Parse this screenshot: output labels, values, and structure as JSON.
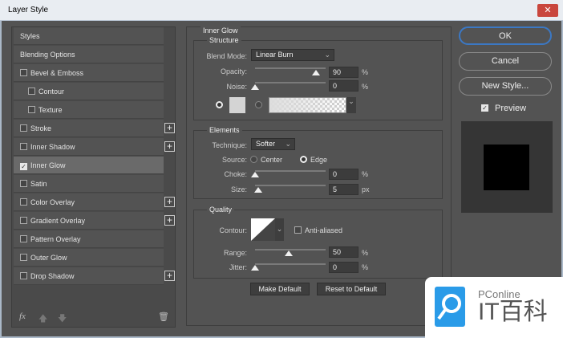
{
  "window": {
    "title": "Layer Style",
    "close": "✕"
  },
  "sidebar": {
    "items": [
      {
        "label": "Styles"
      },
      {
        "label": "Blending Options"
      },
      {
        "label": "Bevel & Emboss"
      },
      {
        "label": "Contour"
      },
      {
        "label": "Texture"
      },
      {
        "label": "Stroke"
      },
      {
        "label": "Inner Shadow"
      },
      {
        "label": "Inner Glow"
      },
      {
        "label": "Satin"
      },
      {
        "label": "Color Overlay"
      },
      {
        "label": "Gradient Overlay"
      },
      {
        "label": "Pattern Overlay"
      },
      {
        "label": "Outer Glow"
      },
      {
        "label": "Drop Shadow"
      }
    ],
    "fx": "fx"
  },
  "panel": {
    "title": "Inner Glow",
    "structure": {
      "title": "Structure",
      "blend_label": "Blend Mode:",
      "blend_value": "Linear Burn",
      "opacity_label": "Opacity:",
      "opacity": "90",
      "noise_label": "Noise:",
      "noise": "0",
      "unit": "%"
    },
    "elements": {
      "title": "Elements",
      "technique_label": "Technique:",
      "technique": "Softer",
      "source_label": "Source:",
      "center": "Center",
      "edge": "Edge",
      "choke_label": "Choke:",
      "choke": "0",
      "size_label": "Size:",
      "size": "5",
      "px": "px"
    },
    "quality": {
      "title": "Quality",
      "contour_label": "Contour:",
      "anti": "Anti-aliased",
      "range_label": "Range:",
      "range": "50",
      "jitter_label": "Jitter:",
      "jitter": "0"
    },
    "make_default": "Make Default",
    "reset_default": "Reset to Default"
  },
  "right": {
    "ok": "OK",
    "cancel": "Cancel",
    "new_style": "New Style...",
    "preview": "Preview"
  },
  "watermark": {
    "brand": "PConline",
    "name": "IT百科"
  }
}
